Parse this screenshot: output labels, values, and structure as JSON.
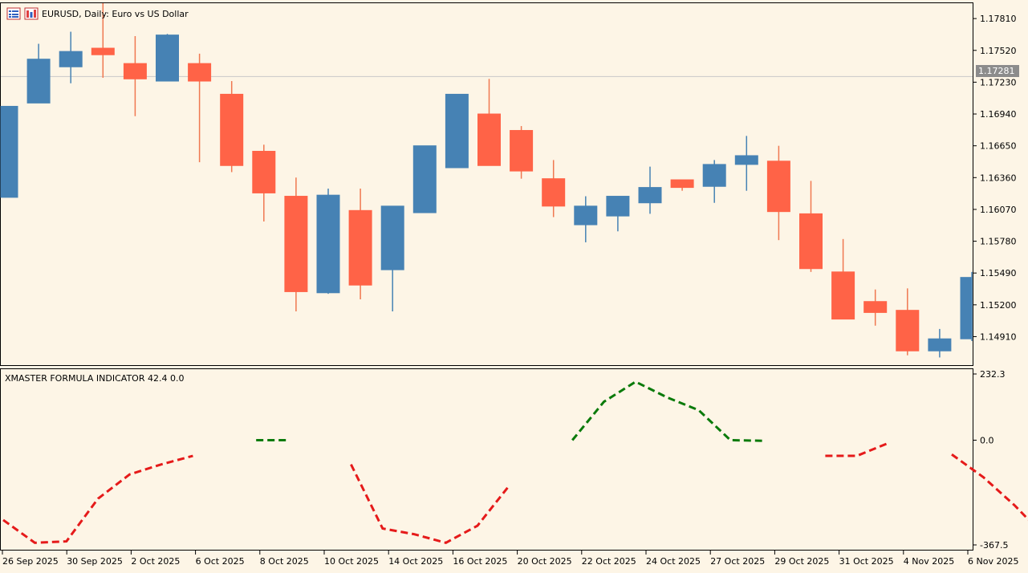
{
  "window": {
    "symbol_title": "EURUSD, Daily:  Euro vs US Dollar"
  },
  "icons": [
    "chart-list-icon",
    "chart-bars-icon"
  ],
  "indicator": {
    "label": "XMASTER FORMULA INDICATOR 42.4 0.0"
  },
  "current_price": "1.17281",
  "colors": {
    "background": "#fdf5e6",
    "bull": "#4682b4",
    "bear": "#ff6347",
    "bear_wick": "#f07850",
    "ind_up": "#0a7a0a",
    "ind_down": "#e51a1a",
    "price_line": "#c8c8c8",
    "price_tag": "#8c8c8c"
  },
  "chart_data": [
    {
      "type": "candlestick",
      "title": "EURUSD, Daily:  Euro vs US Dollar",
      "ylim": [
        1.1465,
        1.1795
      ],
      "y_ticks": [
        "1.17810",
        "1.17520",
        "1.17230",
        "1.16940",
        "1.16650",
        "1.16360",
        "1.16070",
        "1.15780",
        "1.15490",
        "1.15200",
        "1.14910"
      ],
      "x_tick_labels": [
        "26 Sep 2025",
        "30 Sep 2025",
        "2 Oct 2025",
        "6 Oct 2025",
        "8 Oct 2025",
        "10 Oct 2025",
        "14 Oct 2025",
        "16 Oct 2025",
        "20 Oct 2025",
        "22 Oct 2025",
        "24 Oct 2025",
        "27 Oct 2025",
        "29 Oct 2025",
        "31 Oct 2025",
        "4 Nov 2025",
        "6 Nov 2025"
      ],
      "last_price": 1.17281,
      "series": [
        {
          "open": 1.1618,
          "high": 1.1701,
          "low": 1.1618,
          "close": 1.1701
        },
        {
          "open": 1.1704,
          "high": 1.1758,
          "low": 1.1704,
          "close": 1.1744
        },
        {
          "open": 1.1737,
          "high": 1.1769,
          "low": 1.1722,
          "close": 1.1751
        },
        {
          "open": 1.1754,
          "high": 1.1795,
          "low": 1.1727,
          "close": 1.1748
        },
        {
          "open": 1.174,
          "high": 1.1765,
          "low": 1.1692,
          "close": 1.1726
        },
        {
          "open": 1.1724,
          "high": 1.1767,
          "low": 1.1724,
          "close": 1.1766
        },
        {
          "open": 1.174,
          "high": 1.1749,
          "low": 1.165,
          "close": 1.1724
        },
        {
          "open": 1.1712,
          "high": 1.1724,
          "low": 1.1641,
          "close": 1.1647
        },
        {
          "open": 1.166,
          "high": 1.1666,
          "low": 1.1596,
          "close": 1.1622
        },
        {
          "open": 1.1619,
          "high": 1.1636,
          "low": 1.1514,
          "close": 1.1532
        },
        {
          "open": 1.1531,
          "high": 1.1626,
          "low": 1.153,
          "close": 1.162
        },
        {
          "open": 1.1606,
          "high": 1.1626,
          "low": 1.1525,
          "close": 1.1538
        },
        {
          "open": 1.1552,
          "high": 1.1608,
          "low": 1.1514,
          "close": 1.161
        },
        {
          "open": 1.1604,
          "high": 1.1655,
          "low": 1.1604,
          "close": 1.1665
        },
        {
          "open": 1.1645,
          "high": 1.1686,
          "low": 1.1645,
          "close": 1.1712
        },
        {
          "open": 1.1694,
          "high": 1.1726,
          "low": 1.1647,
          "close": 1.1647
        },
        {
          "open": 1.1679,
          "high": 1.1683,
          "low": 1.1635,
          "close": 1.1642
        },
        {
          "open": 1.1635,
          "high": 1.1652,
          "low": 1.16,
          "close": 1.161
        },
        {
          "open": 1.1593,
          "high": 1.1619,
          "low": 1.1577,
          "close": 1.161
        },
        {
          "open": 1.1601,
          "high": 1.1616,
          "low": 1.1587,
          "close": 1.1619
        },
        {
          "open": 1.1613,
          "high": 1.1646,
          "low": 1.1603,
          "close": 1.1627
        },
        {
          "open": 1.1634,
          "high": 1.1633,
          "low": 1.1624,
          "close": 1.1627
        },
        {
          "open": 1.1628,
          "high": 1.1652,
          "low": 1.1613,
          "close": 1.1648
        },
        {
          "open": 1.1648,
          "high": 1.1674,
          "low": 1.1624,
          "close": 1.1656
        },
        {
          "open": 1.1651,
          "high": 1.1665,
          "low": 1.1579,
          "close": 1.1605
        },
        {
          "open": 1.1603,
          "high": 1.1633,
          "low": 1.155,
          "close": 1.1553
        },
        {
          "open": 1.155,
          "high": 1.158,
          "low": 1.152,
          "close": 1.1507
        },
        {
          "open": 1.1523,
          "high": 1.1534,
          "low": 1.1501,
          "close": 1.1513
        },
        {
          "open": 1.1515,
          "high": 1.1535,
          "low": 1.1474,
          "close": 1.1478
        },
        {
          "open": 1.1478,
          "high": 1.1498,
          "low": 1.1472,
          "close": 1.1489
        },
        {
          "open": 1.1489,
          "high": 1.155,
          "low": 1.1487,
          "close": 1.1545
        }
      ]
    },
    {
      "type": "line",
      "title": "XMASTER FORMULA INDICATOR 42.4 0.0",
      "ylim": [
        -367.5,
        232.3
      ],
      "y_ticks": [
        "232.3",
        "0.0",
        "-367.5"
      ],
      "points": [
        -280,
        -360,
        -355,
        -205,
        -120,
        -85,
        -55,
        null,
        0,
        0,
        null,
        -85,
        -310,
        -330,
        -360,
        -300,
        -160,
        null,
        0,
        135,
        205,
        150,
        105,
        0,
        -2,
        null,
        -55,
        -55,
        -10,
        null,
        -50,
        -130,
        -230,
        -345,
        -370
      ],
      "segments": [
        {
          "trend": "down",
          "points": [
            -280,
            -360,
            -355,
            -205,
            -120,
            -85,
            -55
          ]
        },
        {
          "trend": "up",
          "points": [
            0,
            0
          ]
        },
        {
          "trend": "down",
          "points": [
            -85,
            -310,
            -330,
            -360,
            -300,
            -160
          ]
        },
        {
          "trend": "up",
          "points": [
            0,
            135,
            205,
            150,
            105,
            0,
            -2
          ]
        },
        {
          "trend": "down",
          "points": [
            -55,
            -55,
            -10
          ]
        },
        {
          "trend": "down",
          "points": [
            -50,
            -130,
            -230,
            -345,
            -370
          ]
        }
      ]
    }
  ]
}
